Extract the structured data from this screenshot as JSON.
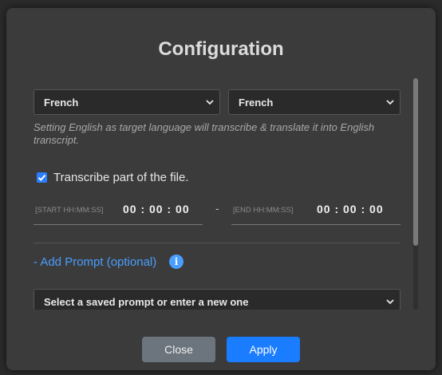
{
  "dialog": {
    "title": "Configuration"
  },
  "languages": {
    "source_value": "French",
    "target_value": "French",
    "hint": "Setting English as target language will transcribe & translate it into English transcript."
  },
  "transcribe_part": {
    "checked": true,
    "label": "Transcribe part of the file.",
    "start_label": "[START HH:MM:SS]",
    "start_value": "00 : 00 : 00",
    "separator": "-",
    "end_label": "[END HH:MM:SS]",
    "end_value": "00 : 00 : 00"
  },
  "prompt": {
    "toggle_label": "- Add Prompt (optional)",
    "info_icon": "info-icon",
    "select_placeholder": "Select a saved prompt or enter a new one"
  },
  "footer": {
    "close_label": "Close",
    "apply_label": "Apply"
  },
  "colors": {
    "accent": "#1a7cff",
    "link": "#4a9eff",
    "modal_bg": "#3b3b3b"
  }
}
